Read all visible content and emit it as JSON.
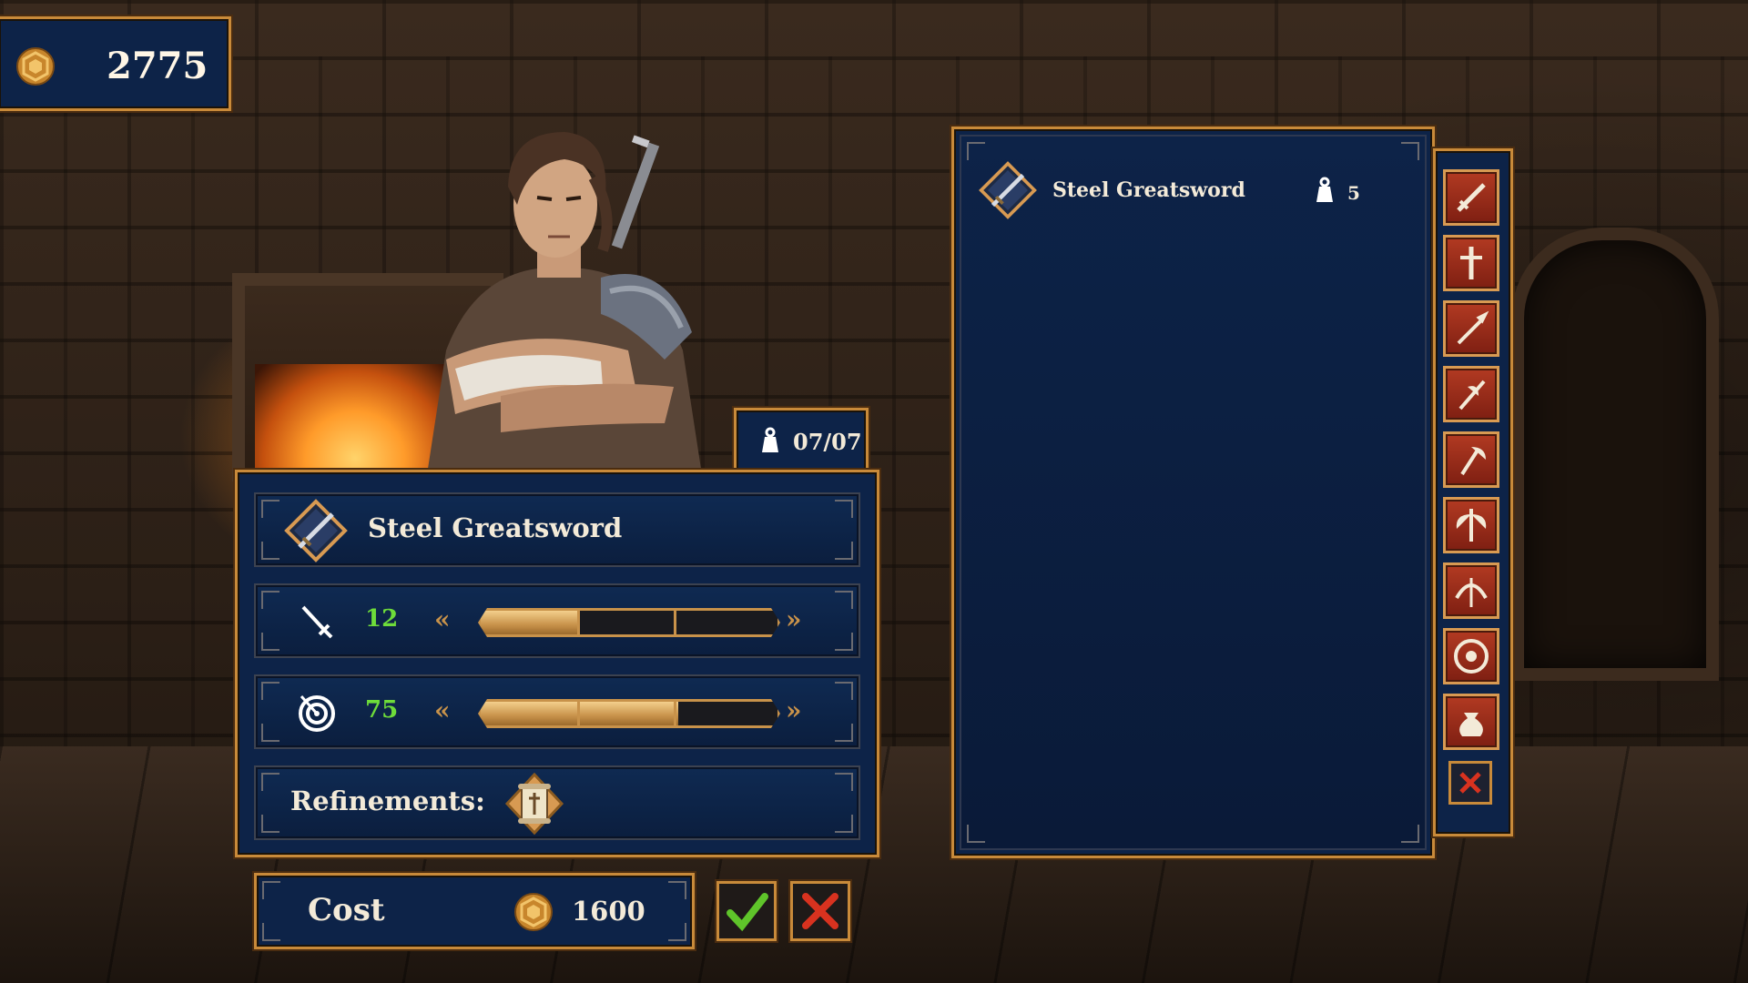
{
  "hud": {
    "gold": "2775"
  },
  "character": {
    "capacity": "07/07"
  },
  "weapon_card": {
    "name": "Steel Greatsword",
    "stats": [
      {
        "icon": "sword-icon",
        "value": "12",
        "level": 1,
        "max_level": 3
      },
      {
        "icon": "target-icon",
        "value": "75",
        "level": 2,
        "max_level": 3
      }
    ],
    "refinements_label": "Refinements:"
  },
  "cost": {
    "label": "Cost",
    "value": "1600"
  },
  "inventory": {
    "items": [
      {
        "name": "Steel Greatsword",
        "quantity": "5"
      }
    ]
  },
  "categories": [
    {
      "icon": "greatsword-icon"
    },
    {
      "icon": "dagger-icon"
    },
    {
      "icon": "spear-icon"
    },
    {
      "icon": "halberd-icon"
    },
    {
      "icon": "hand-axe-icon"
    },
    {
      "icon": "double-axe-icon"
    },
    {
      "icon": "bow-icon"
    },
    {
      "icon": "shield-icon"
    },
    {
      "icon": "pouch-icon"
    },
    {
      "icon": "close-icon"
    }
  ],
  "colors": {
    "panel": "#0d2348",
    "frame_gold": "#c88a3a",
    "stat_green": "#6edc3a",
    "tab_red": "#b23a22",
    "confirm_green": "#5fc42a",
    "cancel_red": "#d8321f"
  }
}
